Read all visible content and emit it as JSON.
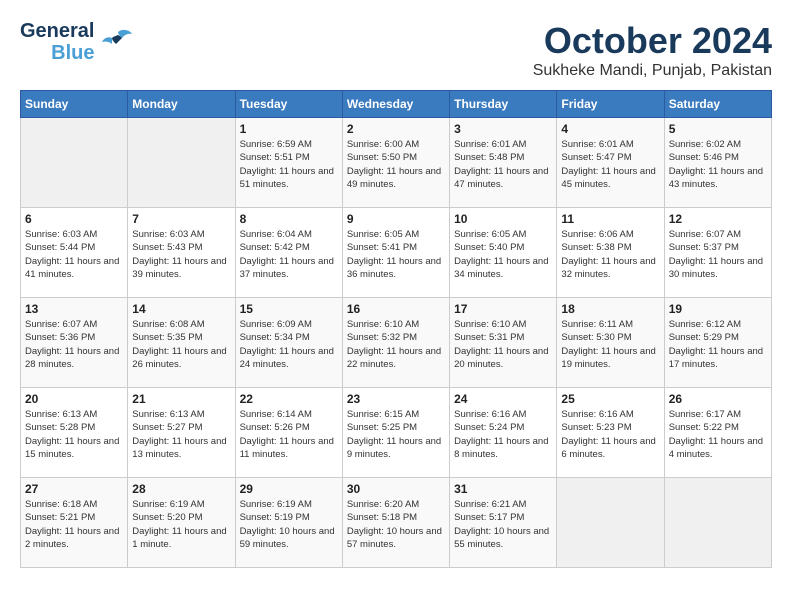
{
  "logo": {
    "general": "General",
    "blue": "Blue"
  },
  "title": "October 2024",
  "location": "Sukheke Mandi, Punjab, Pakistan",
  "days_of_week": [
    "Sunday",
    "Monday",
    "Tuesday",
    "Wednesday",
    "Thursday",
    "Friday",
    "Saturday"
  ],
  "weeks": [
    [
      {
        "day": "",
        "empty": true
      },
      {
        "day": "",
        "empty": true
      },
      {
        "day": "1",
        "sunrise": "6:59 AM",
        "sunset": "5:51 PM",
        "daylight": "11 hours and 51 minutes."
      },
      {
        "day": "2",
        "sunrise": "6:00 AM",
        "sunset": "5:50 PM",
        "daylight": "11 hours and 49 minutes."
      },
      {
        "day": "3",
        "sunrise": "6:01 AM",
        "sunset": "5:48 PM",
        "daylight": "11 hours and 47 minutes."
      },
      {
        "day": "4",
        "sunrise": "6:01 AM",
        "sunset": "5:47 PM",
        "daylight": "11 hours and 45 minutes."
      },
      {
        "day": "5",
        "sunrise": "6:02 AM",
        "sunset": "5:46 PM",
        "daylight": "11 hours and 43 minutes."
      }
    ],
    [
      {
        "day": "6",
        "sunrise": "6:03 AM",
        "sunset": "5:44 PM",
        "daylight": "11 hours and 41 minutes."
      },
      {
        "day": "7",
        "sunrise": "6:03 AM",
        "sunset": "5:43 PM",
        "daylight": "11 hours and 39 minutes."
      },
      {
        "day": "8",
        "sunrise": "6:04 AM",
        "sunset": "5:42 PM",
        "daylight": "11 hours and 37 minutes."
      },
      {
        "day": "9",
        "sunrise": "6:05 AM",
        "sunset": "5:41 PM",
        "daylight": "11 hours and 36 minutes."
      },
      {
        "day": "10",
        "sunrise": "6:05 AM",
        "sunset": "5:40 PM",
        "daylight": "11 hours and 34 minutes."
      },
      {
        "day": "11",
        "sunrise": "6:06 AM",
        "sunset": "5:38 PM",
        "daylight": "11 hours and 32 minutes."
      },
      {
        "day": "12",
        "sunrise": "6:07 AM",
        "sunset": "5:37 PM",
        "daylight": "11 hours and 30 minutes."
      }
    ],
    [
      {
        "day": "13",
        "sunrise": "6:07 AM",
        "sunset": "5:36 PM",
        "daylight": "11 hours and 28 minutes."
      },
      {
        "day": "14",
        "sunrise": "6:08 AM",
        "sunset": "5:35 PM",
        "daylight": "11 hours and 26 minutes."
      },
      {
        "day": "15",
        "sunrise": "6:09 AM",
        "sunset": "5:34 PM",
        "daylight": "11 hours and 24 minutes."
      },
      {
        "day": "16",
        "sunrise": "6:10 AM",
        "sunset": "5:32 PM",
        "daylight": "11 hours and 22 minutes."
      },
      {
        "day": "17",
        "sunrise": "6:10 AM",
        "sunset": "5:31 PM",
        "daylight": "11 hours and 20 minutes."
      },
      {
        "day": "18",
        "sunrise": "6:11 AM",
        "sunset": "5:30 PM",
        "daylight": "11 hours and 19 minutes."
      },
      {
        "day": "19",
        "sunrise": "6:12 AM",
        "sunset": "5:29 PM",
        "daylight": "11 hours and 17 minutes."
      }
    ],
    [
      {
        "day": "20",
        "sunrise": "6:13 AM",
        "sunset": "5:28 PM",
        "daylight": "11 hours and 15 minutes."
      },
      {
        "day": "21",
        "sunrise": "6:13 AM",
        "sunset": "5:27 PM",
        "daylight": "11 hours and 13 minutes."
      },
      {
        "day": "22",
        "sunrise": "6:14 AM",
        "sunset": "5:26 PM",
        "daylight": "11 hours and 11 minutes."
      },
      {
        "day": "23",
        "sunrise": "6:15 AM",
        "sunset": "5:25 PM",
        "daylight": "11 hours and 9 minutes."
      },
      {
        "day": "24",
        "sunrise": "6:16 AM",
        "sunset": "5:24 PM",
        "daylight": "11 hours and 8 minutes."
      },
      {
        "day": "25",
        "sunrise": "6:16 AM",
        "sunset": "5:23 PM",
        "daylight": "11 hours and 6 minutes."
      },
      {
        "day": "26",
        "sunrise": "6:17 AM",
        "sunset": "5:22 PM",
        "daylight": "11 hours and 4 minutes."
      }
    ],
    [
      {
        "day": "27",
        "sunrise": "6:18 AM",
        "sunset": "5:21 PM",
        "daylight": "11 hours and 2 minutes."
      },
      {
        "day": "28",
        "sunrise": "6:19 AM",
        "sunset": "5:20 PM",
        "daylight": "11 hours and 1 minute."
      },
      {
        "day": "29",
        "sunrise": "6:19 AM",
        "sunset": "5:19 PM",
        "daylight": "10 hours and 59 minutes."
      },
      {
        "day": "30",
        "sunrise": "6:20 AM",
        "sunset": "5:18 PM",
        "daylight": "10 hours and 57 minutes."
      },
      {
        "day": "31",
        "sunrise": "6:21 AM",
        "sunset": "5:17 PM",
        "daylight": "10 hours and 55 minutes."
      },
      {
        "day": "",
        "empty": true
      },
      {
        "day": "",
        "empty": true
      }
    ]
  ]
}
